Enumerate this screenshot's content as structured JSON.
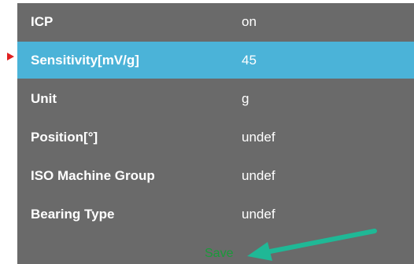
{
  "settings": {
    "rows": [
      {
        "label": "ICP",
        "value": "on"
      },
      {
        "label": "Sensitivity[mV/g]",
        "value": "45"
      },
      {
        "label": "Unit",
        "value": "g"
      },
      {
        "label": "Position[°]",
        "value": "undef"
      },
      {
        "label": "ISO Machine Group",
        "value": "undef"
      },
      {
        "label": "Bearing Type",
        "value": "undef"
      }
    ],
    "save_label": "Save"
  },
  "colors": {
    "panel_background": "#6a6a6a",
    "selected_row": "#4bb3d8",
    "selection_marker": "#e02020",
    "save_text": "#1a9a3a",
    "annotation_arrow": "#1fb896"
  },
  "icons": {
    "selection_marker": "triangle-right-icon",
    "annotation": "arrow-pointer-icon"
  }
}
